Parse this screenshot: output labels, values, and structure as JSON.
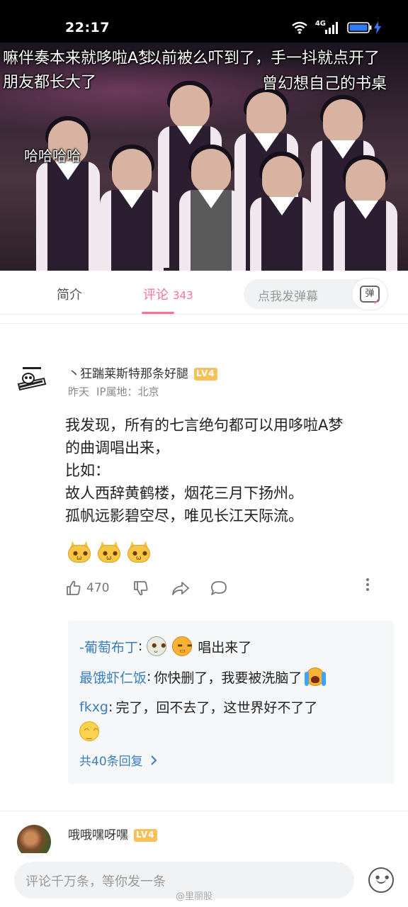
{
  "status_bar": {
    "time": "22:17",
    "network": "4G",
    "icons": [
      "wifi-icon",
      "signal-icon",
      "battery-icon",
      "charging-icon"
    ]
  },
  "video": {
    "danmaku": [
      "嘛伴奏本来就哆啦A梦",
      "以前被么吓到了，手一抖就点开了",
      "朋友都长大了",
      "曾幻想自己的书桌",
      "哈哈哈哈"
    ]
  },
  "tabs": {
    "intro_label": "简介",
    "comments_label": "评论",
    "comments_count": "343",
    "danmaku_placeholder": "点我发弹幕",
    "danmaku_button_glyph": "弹"
  },
  "comment": {
    "username": "丶狂踹莱斯特那条好腿",
    "level": "LV4",
    "time": "昨天",
    "location": "IP属地：北京",
    "lines": [
      "我发现，所有的七言绝句都可以用哆啦A梦",
      "的曲调唱出来，",
      "比如：",
      "故人西辞黄鹤楼，烟花三月下扬州。",
      "孤帆远影碧空尽，唯见长江天际流。"
    ],
    "emoji": [
      "cat-emoji",
      "cat-emoji",
      "cat-emoji"
    ],
    "like_count": "470"
  },
  "replies": {
    "items": [
      {
        "user": "-葡萄布丁",
        "sep": ":",
        "text": "唱出来了"
      },
      {
        "user": "最饿虾仁饭",
        "sep": ":",
        "text": "你快删了，我要被洗脑了"
      },
      {
        "user": "fkxg",
        "sep": ":",
        "text": "完了，回不去了，这世界好不了了"
      }
    ],
    "see_all": "共40条回复"
  },
  "next_comment": {
    "username": "哦哦嘿呀嘿",
    "level": "LV4"
  },
  "bottom_bar": {
    "placeholder": "评论千万条，等你发一条",
    "watermark": "@里丽股"
  },
  "colors": {
    "accent": "#fb7299",
    "link": "#3b7ebc",
    "level_badge": "#f6c05b"
  }
}
